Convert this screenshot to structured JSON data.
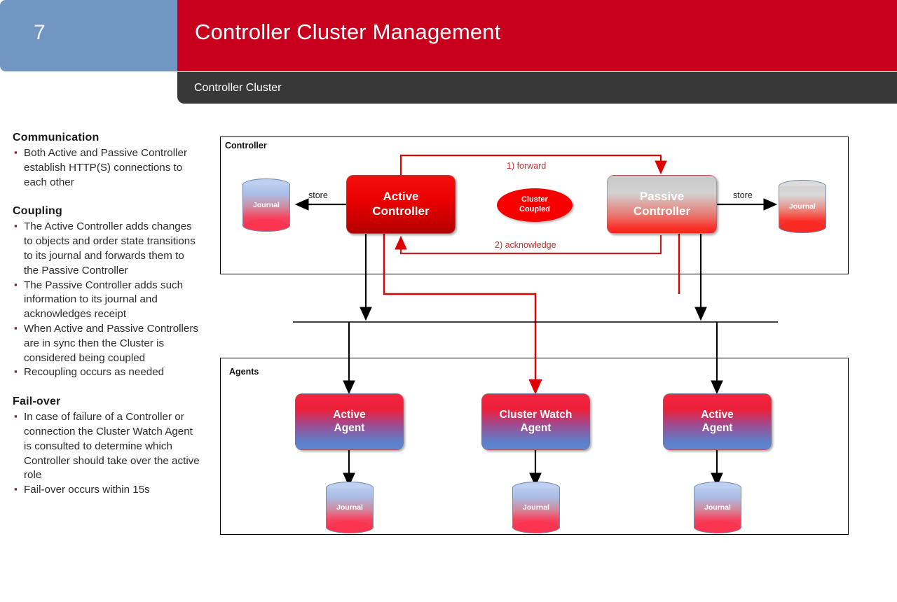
{
  "header": {
    "slide_number": "7",
    "title": "Controller Cluster Management",
    "subtitle": "Controller Cluster"
  },
  "left_column": {
    "sections": [
      {
        "heading": "Communication",
        "bullets": [
          "Both Active and Passive Controller establish HTTP(S) connections to each other"
        ]
      },
      {
        "heading": "Coupling",
        "bullets": [
          "The Active Controller adds changes to objects and order state transitions to its journal and forwards them to the Passive Controller",
          "The Passive Controller adds such information to its journal and acknowledges receipt",
          "When Active and Passive Controllers are in sync then the Cluster is considered being coupled",
          "Recoupling occurs as needed"
        ]
      },
      {
        "heading": "Fail-over",
        "bullets": [
          "In case of failure of a Controller or connection the Cluster Watch Agent is consulted to determine which Controller should take over the active role",
          "Fail-over occurs within 15s"
        ]
      }
    ]
  },
  "diagram": {
    "controller_frame_label": "Controller",
    "agents_frame_label": "Agents",
    "nodes": {
      "journal_left": "Journal",
      "active_controller": "Active\nController",
      "active_controller_line1": "Active",
      "active_controller_line2": "Controller",
      "cluster_coupled_line1": "Cluster",
      "cluster_coupled_line2": "Coupled",
      "passive_controller_line1": "Passive",
      "passive_controller_line2": "Controller",
      "journal_right": "Journal",
      "active_agent_left_line1": "Active",
      "active_agent_left_line2": "Agent",
      "cluster_watch_agent_line1": "Cluster Watch",
      "cluster_watch_agent_line2": "Agent",
      "active_agent_right_line1": "Active",
      "active_agent_right_line2": "Agent",
      "journal_agent_left": "Journal",
      "journal_agent_mid": "Journal",
      "journal_agent_right": "Journal"
    },
    "edge_labels": {
      "store_left": "store",
      "store_right": "store",
      "forward": "1) forward",
      "acknowledge": "2) acknowledge"
    },
    "colors": {
      "brand_red": "#c8001e",
      "accent_blue": "#7296c2",
      "subtitle_bg": "#383838",
      "arrow_red": "#c00000",
      "arrow_black": "#000000",
      "ellipse_red": "#f70000"
    }
  }
}
